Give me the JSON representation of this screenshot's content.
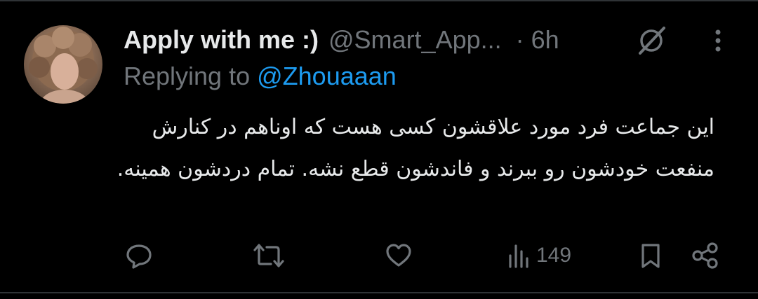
{
  "tweet": {
    "display_name": "Apply with me :)",
    "handle": "@Smart_App...",
    "time": "· 6h",
    "replying_prefix": "Replying to ",
    "replying_to": "@Zhouaaan",
    "text": "این جماعت فرد مورد علاقشون کسی هست که اوناهم در کنارش منفعت خودشون رو ببرند و فاندشون قطع نشه. تمام دردشون همینه.",
    "views": "149"
  },
  "icons": {
    "grok": "grok-slash-icon",
    "more": "vertical-ellipsis-icon",
    "reply": "reply-bubble-icon",
    "retweet": "retweet-icon",
    "like": "heart-icon",
    "views": "bar-chart-icon",
    "bookmark": "bookmark-icon",
    "share": "share-icon"
  },
  "colors": {
    "background": "#000000",
    "text": "#e7e9ea",
    "muted": "#71767b",
    "link": "#1d9bf0",
    "border": "#2f3336"
  }
}
